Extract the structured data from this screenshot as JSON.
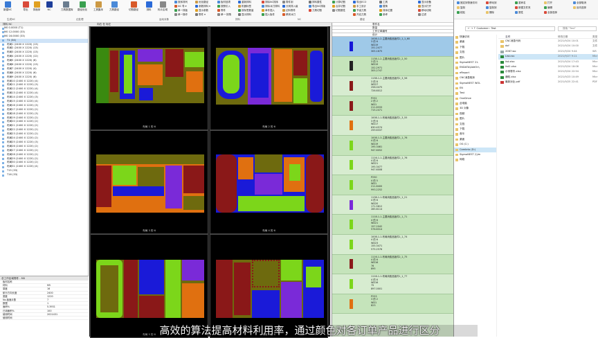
{
  "ribbon": {
    "buttons": [
      "新建NC",
      "导出",
      "排面序",
      "NC",
      "刀具数据库",
      "路径优化",
      "工具集序",
      "刀具路径",
      "切割路径",
      "排料",
      "料片区域"
    ],
    "small": [
      "按序排列",
      "NC 导 ▾",
      "单一排板",
      "单一操作",
      "优化路径",
      "参数排料 ▾",
      "显示参数",
      "零件 ▾",
      "板材选项",
      "按照引入",
      "零件",
      "单一·按角",
      "重新排料",
      "机器标签",
      "按标签数量",
      "显示排料",
      "排除NC排序",
      "排除冰刀排料",
      "单件插入",
      "插入板件",
      "零件到",
      "分到排入级",
      "边料零件",
      "移到冰刀",
      "排料属性",
      "导出NC排版",
      "刀具切割",
      "计算切割",
      "合并切割",
      "切割属性",
      "导出ECO",
      "手工设计",
      "节省刀具",
      "开启刀具",
      "工具",
      "替换",
      "排序位置",
      "参考",
      "显示设备",
      "显示打开",
      "移动切削",
      "过滤"
    ],
    "groups": [
      "生成NC",
      "边处理",
      "运动对象",
      "排料",
      "NC",
      "路径"
    ]
  },
  "tree": {
    "rows": [
      "M0 0.0000 (T1)",
      "M0 12.0000 (33)",
      "M0 16.0000 (33)",
      "T1 (34)",
      "布局1 (2400 X 1220) (13)",
      "布局2 (2400 X 1220) (13)",
      "布局3 (2400 X 1220) (13)",
      "布局4 (2400 X 1220) (12)",
      "布局5 (2400 X 1220) (6)",
      "布局6 (2400 X 1220) (13)",
      "布局7 (2400 X 1220) (4)",
      "布局8 (2400 X 1220) (6)",
      "布局9 (2400 X 1220) (6)",
      "布局10 (2400 X 1220) (4)",
      "布局11 (2400 X 1220) (3)",
      "布局12 (2400 X 1220) (4)",
      "布局13 (2400 X 1220) (4)",
      "布局14 (2400 X 1220) (3)",
      "布局15 (2400 X 1220) (4)",
      "布局16 (2400 X 1220) (3)",
      "布局17 (2400 X 1220) (2)",
      "布局18 (2400 X 1220) (3)",
      "布局19 (2400 X 1220) (2)",
      "布局20 (2400 X 1220) (2)",
      "布局21 (2400 X 1220) (2)",
      "布局22 (2400 X 1220) (2)",
      "布局23 (2400 X 1220) (2)",
      "布局24 (2400 X 1220) (2)",
      "布局25 (2400 X 1220) (3)",
      "布局26 (2400 X 1220) (2)",
      "布局27 (2400 X 1220) (2)",
      "布局28 (2400 X 1220) (2)",
      "布局29 (2400 X 1220) (2)",
      "布局30 (2400 X 1220) (2)",
      "布局31 (2400 X 1220) (4)",
      "T15 (33)",
      "T16 (33)"
    ]
  },
  "tabbar": "排料 NC",
  "props": {
    "title": "总工作区域零件 - M0",
    "rows": [
      [
        "板材名称",
        ""
      ],
      [
        "材料",
        "M5"
      ],
      [
        "厚度",
        "16"
      ],
      [
        "航行方向长度",
        "2400"
      ],
      [
        "宽度",
        "1220"
      ],
      [
        "No.板面片数",
        "7"
      ],
      [
        "数据",
        "1"
      ],
      [
        "面积%",
        "5.3931"
      ],
      [
        "已用面积%",
        "100"
      ],
      [
        "使用时间",
        "2021431"
      ],
      [
        "使用时间",
        ""
      ]
    ]
  },
  "grid": {
    "labels": [
      "布局 1 的 6",
      "布局 2 的 6",
      "布局 3 的 6",
      "布局 4 的 6",
      "布局 5 的 6",
      "布局 6 的 6"
    ],
    "scroll_label": "向右 在 标左"
  },
  "list": {
    "headers": [
      "零件名",
      "数量",
      "工作订单编号",
      "设计"
    ],
    "items": [
      {
        "lines": [
          "1008-1-2-主要消费品板件2_1_1_60",
          "3 的 6",
          "WD19",
          "151.2477",
          "305.1675"
        ],
        "color": "#1515d8"
      },
      {
        "lines": [
          "1138-1-2-主要消费品板件2_2_50",
          "3 的 5",
          "WD19",
          "152.2971",
          "305.2747"
        ],
        "color": "#222"
      },
      {
        "lines": [
          "1138-1-2-主要消费品板件2_3_56",
          "3 的 8",
          "WD27",
          "256.0475",
          "726.6012"
        ],
        "color": "#8a1a1a"
      },
      {
        "lines": [
          "P252",
          "2 的 2",
          "WD1",
          "211.8333",
          "715.2471"
        ],
        "color": "#8a1a1a"
      },
      {
        "lines": [
          "1008-1-1-布局消费品板件1_3_55",
          "3 的 6",
          "WD17",
          "630.4574",
          "259.6337"
        ],
        "color": "#e07010"
      },
      {
        "lines": [
          "1008-1-3-主要消费品板件1_1_76",
          "4 的 6",
          "WD19",
          "195.3461",
          "947.6052"
        ],
        "color": "#7cd61a"
      },
      {
        "lines": [
          "1116-1-1-主要消费品板件2_1_76",
          "4 的 6",
          "WD21",
          "195.3477",
          "947.6008"
        ],
        "color": "#7cd61a"
      },
      {
        "lines": [
          "P250",
          "4 的 5",
          "WD1",
          "211.8400",
          "993.2252"
        ],
        "color": "#7cd61a"
      },
      {
        "lines": [
          "1138-1-1-布局消费品板件1_1_21",
          "4 的 6",
          "WD20",
          "171.5812",
          "285.8114"
        ],
        "color": "#7a2ad8"
      },
      {
        "lines": [
          "1118-1-1-主要消费品板件1_1_71",
          "4 的 6",
          "WD21",
          "157.2042",
          "576.8314"
        ],
        "color": "#7cd61a"
      },
      {
        "lines": [
          "1008-1-1-布局消费品板件1_1_74",
          "4 的 6",
          "WD23",
          "155.3471",
          "575.2576"
        ],
        "color": "#7cd61a"
      },
      {
        "lines": [
          "1116-1-1-布局消费品板件2_1_75",
          "4 的 6",
          "WD16",
          "76",
          "895"
        ],
        "color": "#8a1a1a"
      },
      {
        "lines": [
          "1116-1-1-布局消费品板件1_1_77",
          "4 的 6",
          "WD16",
          "75",
          "897.0001"
        ],
        "color": "#7cd61a"
      },
      {
        "lines": [
          "P253",
          "3 的 2",
          "WD1",
          "823"
        ],
        "color": "#e07010"
      }
    ]
  },
  "explorer": {
    "address": "← → ↑  Customer › Test",
    "search": "搜索 \"Test\"",
    "ribbon_labels": [
      "固定到快速访问",
      "复制",
      "粘贴",
      "移动到",
      "复制到",
      "删除",
      "重命名",
      "新建文件夹",
      "属性",
      "打开",
      "编辑",
      "全部选择",
      "全部取消",
      "反向选择"
    ],
    "nav": [
      "快速访问",
      "桌面",
      "下载",
      "文档",
      "图片",
      "SigmaNEST 21.",
      "ENDATA\\AddOn\\",
      "eReport",
      "CNC消息程序",
      "SigmaNEST WOL",
      "EN",
      "Test",
      "OneDrive",
      "此电脑",
      "3D 对象",
      "视频",
      "图片",
      "文档",
      "下载",
      "音乐",
      "桌面",
      "OS (C:)",
      "Cambrio (D:)",
      "SigmaNEST (\\\\Im",
      "网络"
    ],
    "columns": [
      "名称",
      "修改日期",
      "类型"
    ],
    "files": [
      {
        "name": "CNC消息代码",
        "date": "2021/9/24 10:01",
        "type": "文件",
        "color": "#e9c46a"
      },
      {
        "name": "dxf",
        "date": "2021/9/24 10:00",
        "type": "文件",
        "color": "#e9c46a"
      },
      {
        "name": "2067.wo",
        "date": "2021/9/24 9:44",
        "type": "WS",
        "color": "#9aa"
      },
      {
        "name": "List.csv",
        "date": "2021/9/27 9:11",
        "type": "Micr",
        "color": "#2a8a3a"
      },
      {
        "name": "list.xlsx",
        "date": "2021/9/24 17:43",
        "type": "Micr",
        "color": "#2a8a3a"
      },
      {
        "name": "list2.xlsx",
        "date": "2021/9/24 18:06",
        "type": "Micr",
        "color": "#2a8a3a"
      },
      {
        "name": "示例零件.xlsx",
        "date": "2021/9/24 22:54",
        "type": "Micr",
        "color": "#2a8a3a"
      },
      {
        "name": "通知.xlsx",
        "date": "2021/9/23 10:49",
        "type": "Micr",
        "color": "#2a8a3a"
      },
      {
        "name": "最新对比.pdf",
        "date": "2021/9/25 22:41",
        "type": "PDF",
        "color": "#c33"
      }
    ]
  },
  "subtitle": "高效的算法提高材料利用率，通过颜色对各订单产品进行区分"
}
